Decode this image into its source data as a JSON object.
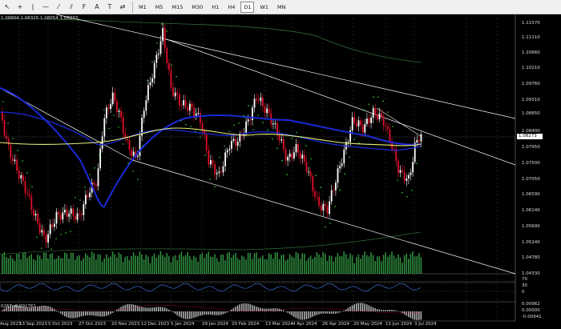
{
  "toolbar": {
    "tools": [
      {
        "name": "cursor-icon",
        "glyph": "↖"
      },
      {
        "name": "crosshair-icon",
        "glyph": "+"
      },
      {
        "name": "vertical-line-icon",
        "glyph": "|"
      },
      {
        "name": "horizontal-line-icon",
        "glyph": "—"
      },
      {
        "name": "trendline-icon",
        "glyph": "⁄"
      },
      {
        "name": "channel-icon",
        "glyph": "⫽"
      },
      {
        "name": "fibonacci-icon",
        "glyph": "F"
      },
      {
        "name": "text-icon",
        "glyph": "A"
      },
      {
        "name": "label-icon",
        "glyph": "T"
      },
      {
        "name": "arrows-icon",
        "glyph": "⇄"
      }
    ],
    "timeframes": [
      "M1",
      "M5",
      "M15",
      "M30",
      "H1",
      "H4",
      "D1",
      "W1",
      "MN"
    ],
    "active_timeframe": "D1"
  },
  "ohlc_header": "1.08804 1.08325 1.08054 1.08273",
  "price_axis": {
    "labels": [
      "1.11570",
      "1.11110",
      "1.10660",
      "1.10210",
      "1.09760",
      "1.09310",
      "1.08850",
      "1.08400",
      "1.07950",
      "1.07500",
      "1.07050",
      "1.06590",
      "1.06140",
      "1.05690",
      "1.05240",
      "1.04780",
      "1.04330"
    ],
    "current_price": "1.08273",
    "rsi_labels": [
      "70",
      "30",
      "0"
    ],
    "macd_labels": [
      "0.00962",
      "0.00000",
      "-0.00941"
    ]
  },
  "indicator_text": {
    "macd_header": "0267 -0.001761"
  },
  "date_axis": {
    "labels": [
      "Aug 2023",
      "13 Sep 2023",
      "5 Oct 2023",
      "27 Oct 2023",
      "20 Nov 2023",
      "12 Dec 2023",
      "5 Jan 2024",
      "29 Jan 2024",
      "20 Feb 2024",
      "13 Mar 2024",
      "4 Apr 2024",
      "26 Apr 2024",
      "20 May 2024",
      "11 Jun 2024",
      "3 Jul 2024"
    ]
  },
  "colors": {
    "bull": "#ffffff",
    "bear": "#e0102a",
    "ma_slow": "#1a2ad8",
    "ma_fast": "#e8f078",
    "sar": "#38d838",
    "trendlines": "#ffffff",
    "volume": "#2e8b3e",
    "rsi": "#3b6fd4"
  }
}
